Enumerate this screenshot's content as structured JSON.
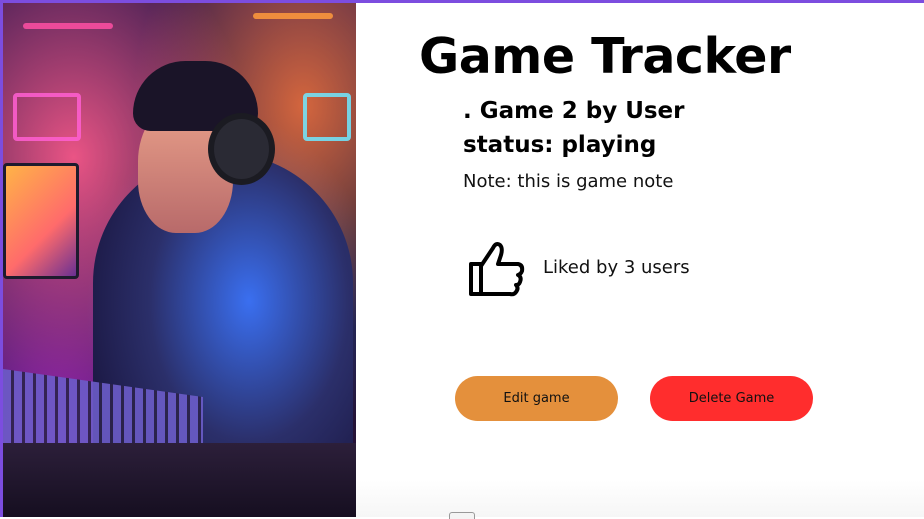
{
  "app": {
    "title": "Game Tracker"
  },
  "game": {
    "name_line": ". Game 2 by User",
    "status_line": "status: playing",
    "note_line": "Note: this is game note"
  },
  "likes": {
    "icon": "thumbs-up-icon",
    "text": "Liked by 3 users"
  },
  "actions": {
    "edit_label": "Edit game",
    "delete_label": "Delete Game"
  },
  "hero_image": {
    "alt": "illustration of a gamer with headset in neon-lit room"
  },
  "colors": {
    "frame": "#7c4ddf",
    "edit_button": "#e4903c",
    "delete_button": "#ff2d2d"
  }
}
